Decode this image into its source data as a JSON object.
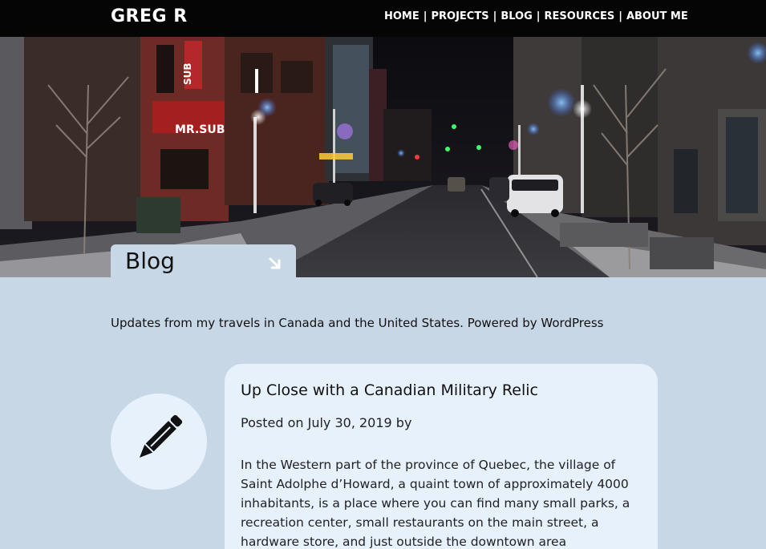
{
  "site": {
    "logo": "GREG R"
  },
  "nav": {
    "items": [
      {
        "label": "HOME"
      },
      {
        "label": "PROJECTS"
      },
      {
        "label": "BLOG"
      },
      {
        "label": "RESOURCES"
      },
      {
        "label": "ABOUT ME"
      }
    ],
    "separator": "|"
  },
  "hero": {
    "signs": {
      "sub_sign": "SUB",
      "mr_sub": "MR.SUB"
    }
  },
  "blog": {
    "title": "Blog",
    "tagline": "Updates from my travels in Canada and the United States. Powered by WordPress"
  },
  "post": {
    "title": "Up Close with a Canadian Military Relic",
    "posted_prefix": "Posted on",
    "date": "July 30, 2019",
    "by": "by",
    "excerpt": "In the Western part of the province of Quebec, the village of Saint Adolphe d’Howard, a quaint town of approximately 4000 inhabitants, is a place where you can find many small parks, a recreation center, small restaurants on the main street, a hardware store, and just outside the downtown area"
  },
  "colors": {
    "topbar": "#050505",
    "page_bg": "#c8d7e6",
    "card_bg": "#e6f1fc"
  },
  "icons": {
    "blog_tab": "arrow-down-right-icon",
    "avatar": "pencil-icon"
  }
}
